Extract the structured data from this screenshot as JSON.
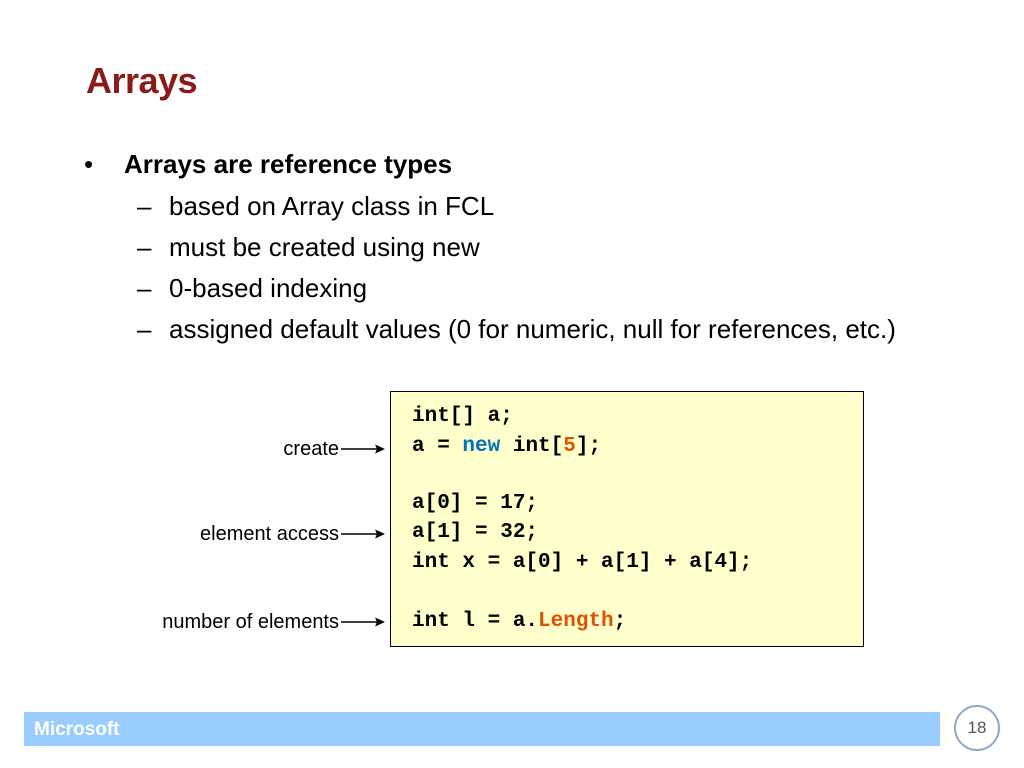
{
  "slide": {
    "title": "Arrays",
    "bullet": "Arrays are reference types",
    "bullet_symbol": "•",
    "dash_symbol": "–",
    "sub_bullets": [
      "based on Array class in FCL",
      "must be created using new",
      "0-based indexing",
      "assigned default values (0 for numeric, null for references, etc.)"
    ]
  },
  "code": {
    "line1": "int[] a;",
    "line2": {
      "part1": "a = ",
      "keyword": "new",
      "part2": " int[",
      "number": "5",
      "part3": "];"
    },
    "line3": "a[0] = 17;",
    "line4": "a[1] = 32;",
    "line5": "int x = a[0] + a[1] + a[4];",
    "line6": {
      "part1": "int l = a.",
      "property": "Length",
      "part2": ";"
    }
  },
  "annotations": {
    "create": "create",
    "element_access": "element access",
    "number_of_elements": "number of elements"
  },
  "footer": {
    "brand": "Microsoft",
    "page_number": "18"
  },
  "colors": {
    "title": "#8b1a1a",
    "keyword": "#0070c0",
    "literal": "#e05000",
    "code_background": "#ffffcc",
    "footer_bar": "#99ccff"
  }
}
